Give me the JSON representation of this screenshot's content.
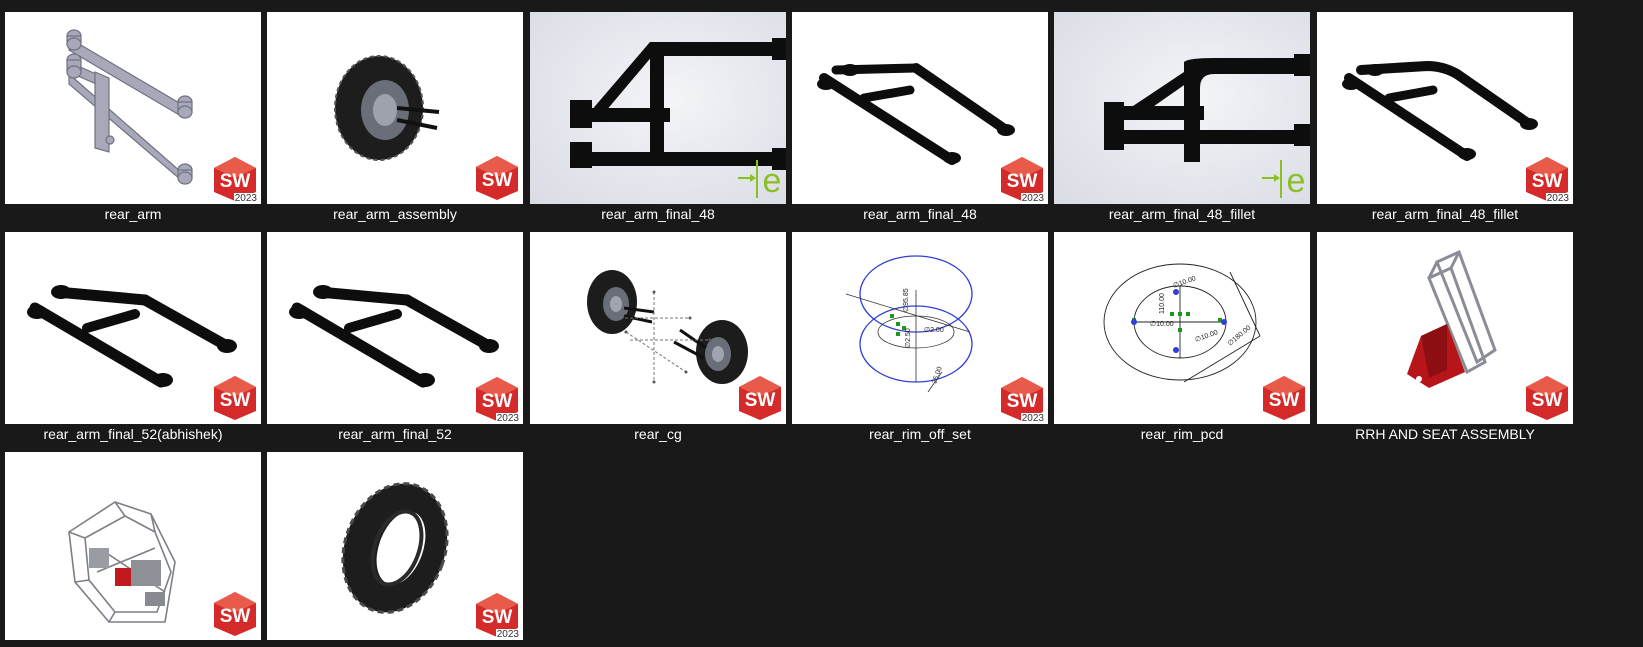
{
  "files": [
    {
      "name": "rear_arm",
      "badge": "solidworks",
      "year": "2023",
      "preview": "rear-arm-grey"
    },
    {
      "name": "rear_arm_assembly",
      "badge": "solidworks",
      "year": "",
      "preview": "wheel-assembly"
    },
    {
      "name": "rear_arm_final_48",
      "badge": "edrawings",
      "year": "",
      "preview": "rear-arm-front"
    },
    {
      "name": "rear_arm_final_48",
      "badge": "solidworks",
      "year": "2023",
      "preview": "rear-arm-black"
    },
    {
      "name": "rear_arm_final_48_fillet",
      "badge": "edrawings",
      "year": "",
      "preview": "rear-arm-front-fillet"
    },
    {
      "name": "rear_arm_final_48_fillet",
      "badge": "solidworks",
      "year": "2023",
      "preview": "rear-arm-black-fillet"
    },
    {
      "name": "rear_arm_final_52(abhishek)",
      "badge": "solidworks",
      "year": "",
      "preview": "rear-arm-black-52"
    },
    {
      "name": "rear_arm_final_52",
      "badge": "solidworks",
      "year": "2023",
      "preview": "rear-arm-black-52"
    },
    {
      "name": "rear_cg",
      "badge": "solidworks",
      "year": "",
      "preview": "rear-cg"
    },
    {
      "name": "rear_rim_off_set",
      "badge": "solidworks",
      "year": "2023",
      "preview": "sketch-offset"
    },
    {
      "name": "rear_rim_pcd",
      "badge": "solidworks",
      "year": "",
      "preview": "sketch-pcd"
    },
    {
      "name": "RRH AND SEAT ASSEMBLY",
      "badge": "solidworks",
      "year": "",
      "preview": "rrh-seat"
    },
    {
      "name": "",
      "badge": "solidworks",
      "year": "",
      "preview": "chassis"
    },
    {
      "name": "",
      "badge": "solidworks",
      "year": "2023",
      "preview": "tire"
    }
  ],
  "sketch_dims": {
    "offset": [
      "∅95.85",
      "∅2.00",
      "∅2.50",
      "25.00"
    ],
    "pcd": [
      "∅10.00",
      "110.00",
      "∅10.00",
      "∅10.00",
      "∅180.00"
    ]
  },
  "badges": {
    "solidworks_text": "SW",
    "edrawings_text": "e"
  },
  "colors": {
    "background": "#191919",
    "label": "#ffffff",
    "sw_red": "#d42a2a",
    "edraw_green": "#8cbf26"
  }
}
